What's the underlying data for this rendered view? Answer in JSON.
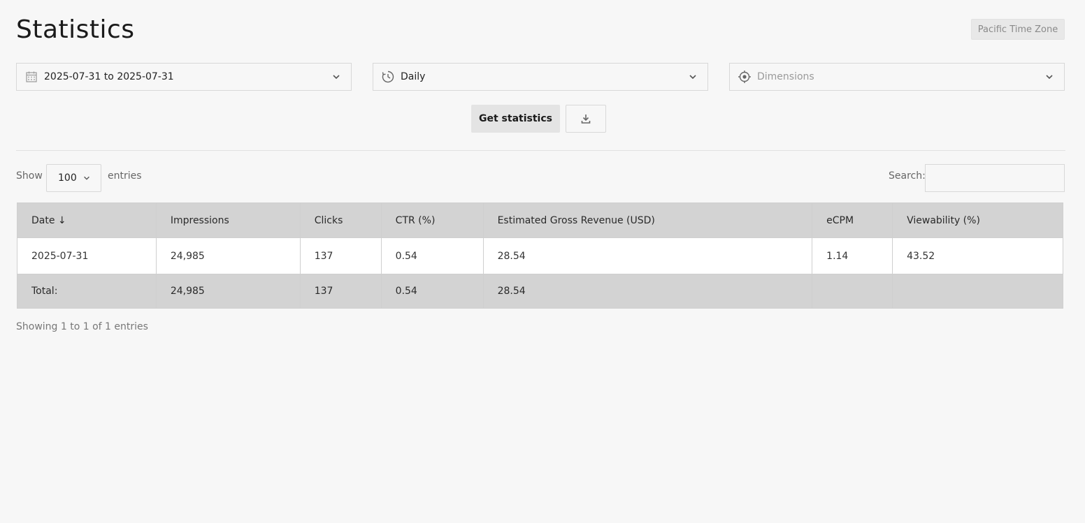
{
  "page": {
    "title": "Statistics",
    "timezone_badge": "Pacific Time Zone"
  },
  "filters": {
    "date_range": {
      "value": "2025-07-31 to 2025-07-31",
      "icon": "calendar-icon"
    },
    "interval": {
      "value": "Daily",
      "icon": "clock-icon"
    },
    "dimensions": {
      "placeholder": "Dimensions",
      "icon": "target-icon"
    }
  },
  "actions": {
    "get_statistics_label": "Get statistics",
    "download_icon": "download-icon"
  },
  "table_controls": {
    "show_label": "Show",
    "page_length": "100",
    "entries_label": "entries",
    "search_label": "Search:",
    "search_value": ""
  },
  "table": {
    "columns": [
      "Date ↓",
      "Impressions",
      "Clicks",
      "CTR (%)",
      "Estimated Gross Revenue (USD)",
      "eCPM",
      "Viewability (%)"
    ],
    "rows": [
      [
        "2025-07-31",
        "24,985",
        "137",
        "0.54",
        "28.54",
        "1.14",
        "43.52"
      ]
    ],
    "footer": [
      "Total:",
      "24,985",
      "137",
      "0.54",
      "28.54",
      "",
      ""
    ]
  },
  "info": "Showing 1 to 1 of 1 entries"
}
